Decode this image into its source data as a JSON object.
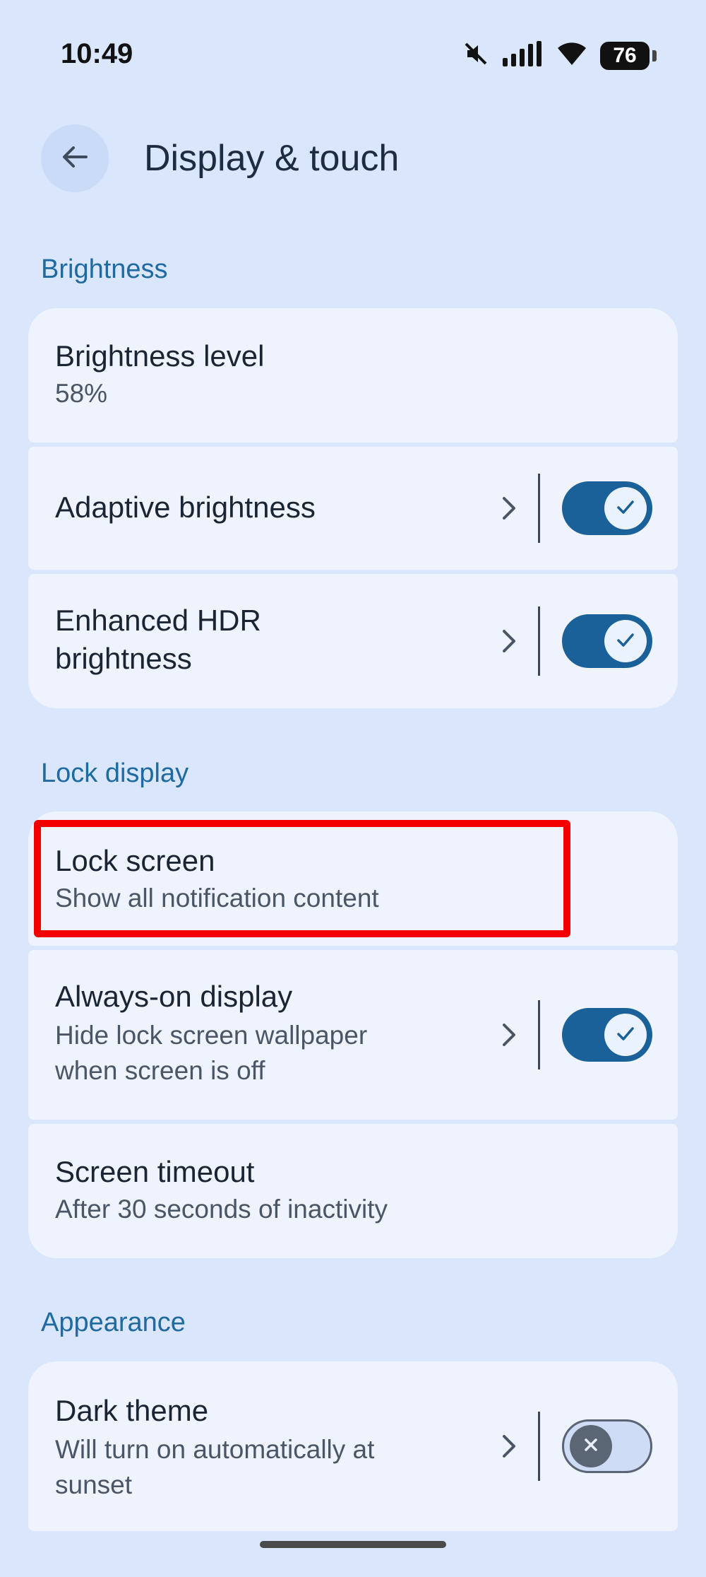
{
  "status_bar": {
    "time": "10:49",
    "battery": "76"
  },
  "header": {
    "title": "Display & touch"
  },
  "sections": {
    "brightness": "Brightness",
    "lock_display": "Lock display",
    "appearance": "Appearance"
  },
  "items": {
    "brightness_level": {
      "title": "Brightness level",
      "sub": "58%"
    },
    "adaptive_brightness": {
      "title": "Adaptive brightness",
      "enabled": true
    },
    "enhanced_hdr": {
      "title_line1": "Enhanced HDR",
      "title_line2": "brightness",
      "enabled": true
    },
    "lock_screen": {
      "title": "Lock screen",
      "sub": "Show all notification content"
    },
    "always_on": {
      "title": "Always-on display",
      "sub_line1": "Hide lock screen wallpaper",
      "sub_line2": "when screen is off",
      "enabled": true
    },
    "screen_timeout": {
      "title": "Screen timeout",
      "sub": "After 30 seconds of inactivity"
    },
    "dark_theme": {
      "title": "Dark theme",
      "sub_line1": "Will turn on automatically at",
      "sub_line2": "sunset",
      "enabled": false
    }
  },
  "colors": {
    "accent": "#1a6099",
    "section": "#1f6aa0",
    "background": "#d9e6fb",
    "card": "#eef3fd",
    "highlight": "#f50000"
  }
}
